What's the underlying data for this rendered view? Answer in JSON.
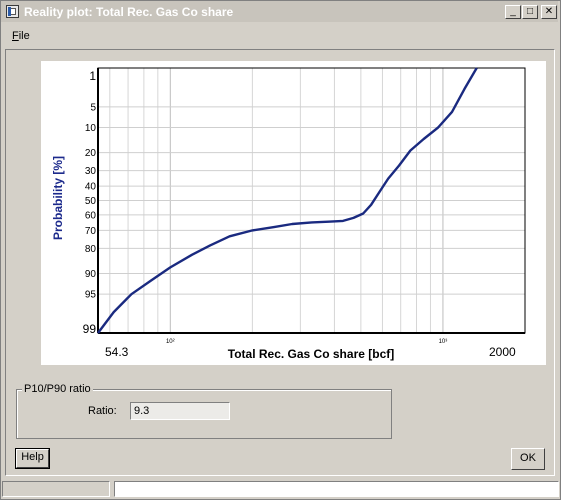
{
  "window": {
    "title": "Reality plot: Total Rec. Gas Co share",
    "controls": {
      "minimize": "_",
      "maximize": "□",
      "close": "✕"
    }
  },
  "menu": {
    "items": [
      {
        "label": "File",
        "mnemonic": "F"
      }
    ]
  },
  "chart_data": {
    "type": "line",
    "title": "",
    "xlabel": "Total Rec. Gas Co share [bcf]",
    "ylabel": "Probability [%]",
    "x_scale": "log",
    "xlim": [
      54.3,
      2000
    ],
    "x_min_label": "54.3",
    "x_max_label": "2000",
    "x_minor_labels": [
      "10²",
      "10³"
    ],
    "x_minor_label_values": [
      100,
      1000
    ],
    "y_scale": "probability",
    "ylim": [
      99,
      1
    ],
    "y_ticks": [
      1,
      5,
      10,
      20,
      30,
      40,
      50,
      60,
      70,
      80,
      90,
      95,
      99
    ],
    "grid": true,
    "line_color": "#1a2a80",
    "label_color": "#1c2a8c",
    "series": [
      {
        "x": [
          54.3,
          62,
          72,
          85,
          100,
          120,
          140,
          165,
          200,
          240,
          280,
          330,
          380,
          430,
          470,
          510,
          545,
          585,
          630,
          690,
          760,
          850,
          960,
          1080,
          1200,
          1330
        ],
        "y": [
          99,
          97.5,
          95,
          92,
          88,
          83,
          78.5,
          73.5,
          70,
          68,
          66,
          65,
          64.5,
          64,
          62,
          59,
          53,
          44,
          35,
          27,
          19,
          14,
          10,
          6,
          2.5,
          0.6
        ]
      }
    ]
  },
  "ratio_group": {
    "legend": "P10/P90 ratio",
    "label": "Ratio:",
    "value": "9.3"
  },
  "buttons": {
    "help": "Help",
    "ok": "OK"
  }
}
